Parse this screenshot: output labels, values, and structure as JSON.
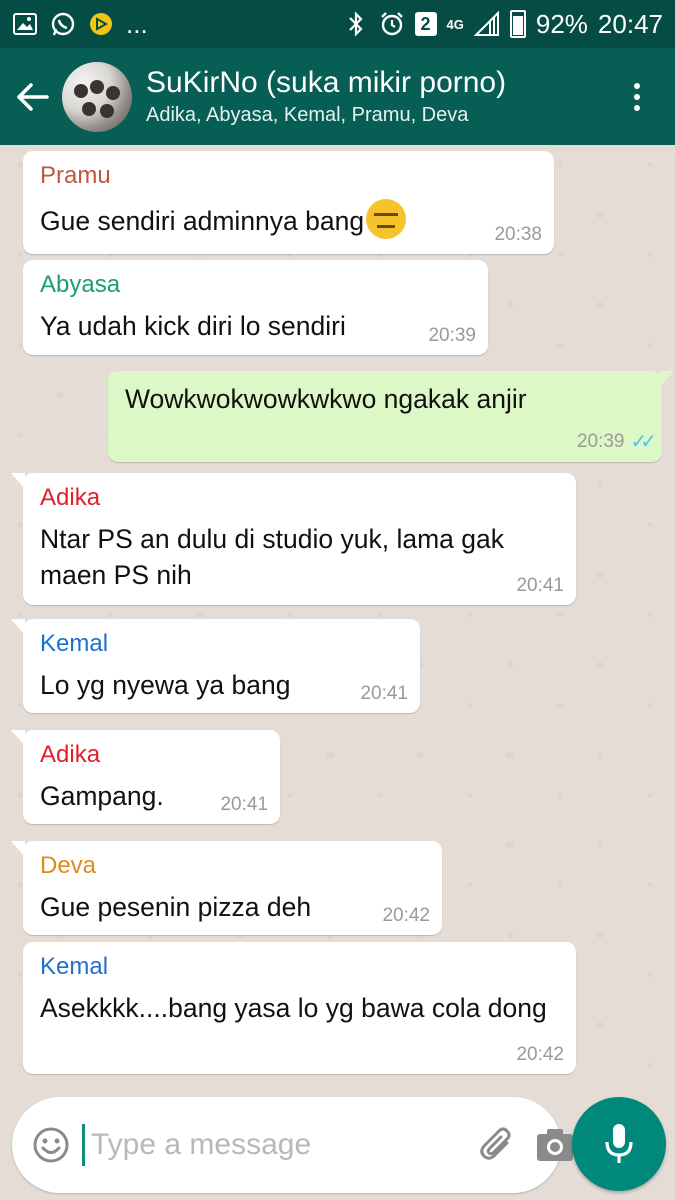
{
  "status_bar": {
    "battery": "92%",
    "time": "20:47",
    "sim_badge": "2",
    "network": "4G",
    "more": "..."
  },
  "header": {
    "title": "SuKirNo (suka mikir porno)",
    "participants": "Adika, Abyasa, Kemal, Pramu, Deva"
  },
  "messages": [
    {
      "sender": "Pramu",
      "text": "Gue sendiri adminnya bang",
      "time": "20:38",
      "sender_color": "#c0573a"
    },
    {
      "sender": "Abyasa",
      "text": "Ya udah kick diri lo sendiri",
      "time": "20:39",
      "sender_color": "#1f9e6b"
    },
    {
      "sender": "",
      "text": "Wowkwokwowkwkwo ngakak anjir",
      "time": "20:39",
      "outgoing": true
    },
    {
      "sender": "Adika",
      "text": "Ntar PS an dulu di studio yuk, lama gak maen PS nih",
      "time": "20:41",
      "sender_color": "#e0202a"
    },
    {
      "sender": "Kemal",
      "text": "Lo yg nyewa ya bang",
      "time": "20:41",
      "sender_color": "#1f6fcf"
    },
    {
      "sender": "Adika",
      "text": "Gampang.",
      "time": "20:41",
      "sender_color": "#e0202a"
    },
    {
      "sender": "Deva",
      "text": "Gue pesenin pizza deh",
      "time": "20:42",
      "sender_color": "#e08a1e"
    },
    {
      "sender": "Kemal",
      "text": "Asekkkk....bang yasa lo yg bawa cola dong",
      "time": "20:42",
      "sender_color": "#1f6fcf"
    }
  ],
  "composer": {
    "placeholder": "Type a message"
  },
  "colors": {
    "header": "#075e54",
    "status_bar": "#054d44",
    "outgoing_bubble": "#dcf8c6",
    "mic_button": "#00897b",
    "read_ticks": "#4fc3f7"
  }
}
